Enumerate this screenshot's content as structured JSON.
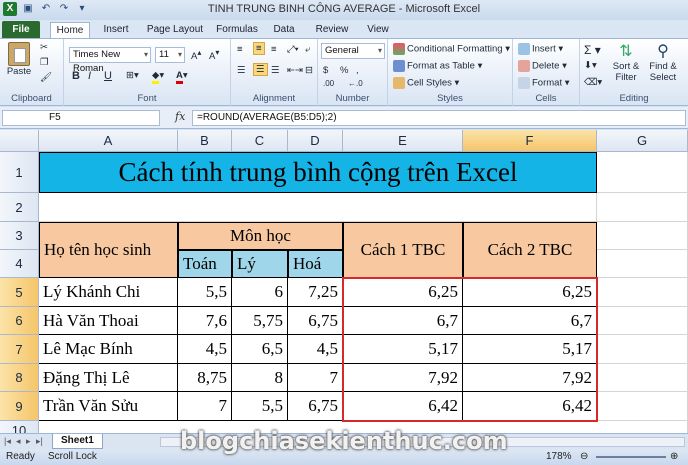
{
  "window": {
    "title": "TINH TRUNG BINH CÔNG AVERAGE - Microsoft Excel"
  },
  "ribbon_tabs": [
    "File",
    "Home",
    "Insert",
    "Page Layout",
    "Formulas",
    "Data",
    "Review",
    "View"
  ],
  "ribbon": {
    "clipboard": {
      "label": "Clipboard",
      "paste": "Paste"
    },
    "font": {
      "label": "Font",
      "font_name": "Times New Roman",
      "font_size": "11",
      "bold": "B",
      "italic": "I",
      "underline": "U"
    },
    "alignment": {
      "label": "Alignment"
    },
    "number": {
      "label": "Number",
      "format": "General",
      "currency": "$",
      "percent": "%",
      "comma": ",",
      "inc_decimal": ".00",
      "dec_decimal": "←.0"
    },
    "styles": {
      "label": "Styles",
      "conditional": "Conditional Formatting",
      "format_table": "Format as Table",
      "cell_styles": "Cell Styles"
    },
    "cells": {
      "label": "Cells",
      "insert": "Insert",
      "delete": "Delete",
      "format": "Format"
    },
    "editing": {
      "label": "Editing",
      "sum": "Σ",
      "sort_filter": "Sort & Filter",
      "find_select": "Find & Select"
    }
  },
  "formula_bar": {
    "name_box": "F5",
    "fx": "fx",
    "formula": "=ROUND(AVERAGE(B5:D5);2)"
  },
  "columns": [
    "A",
    "B",
    "C",
    "D",
    "E",
    "F",
    "G"
  ],
  "rows": [
    "1",
    "2",
    "3",
    "4",
    "5",
    "6",
    "7",
    "8",
    "9",
    "10"
  ],
  "sheet": {
    "title": "Cách tính trung bình cộng trên Excel",
    "header_name": "Họ tên học sinh",
    "header_subjects": "Môn học",
    "header_method1": "Cách 1 TBC",
    "header_method2": "Cách 2 TBC",
    "subjects": [
      "Toán",
      "Lý",
      "Hoá"
    ],
    "students": [
      {
        "name": "Lý Khánh Chi",
        "toan": "5,5",
        "ly": "6",
        "hoa": "7,25",
        "tbc1": "6,25",
        "tbc2": "6,25"
      },
      {
        "name": "Hà Văn Thoai",
        "toan": "7,6",
        "ly": "5,75",
        "hoa": "6,75",
        "tbc1": "6,7",
        "tbc2": "6,7"
      },
      {
        "name": "Lê Mạc Bính",
        "toan": "4,5",
        "ly": "6,5",
        "hoa": "4,5",
        "tbc1": "5,17",
        "tbc2": "5,17"
      },
      {
        "name": "Đặng Thị Lê",
        "toan": "8,75",
        "ly": "8",
        "hoa": "7",
        "tbc1": "7,92",
        "tbc2": "7,92"
      },
      {
        "name": "Trần Văn Sửu",
        "toan": "7",
        "ly": "5,5",
        "hoa": "6,75",
        "tbc1": "6,42",
        "tbc2": "6,42"
      }
    ]
  },
  "sheet_tab": "Sheet1",
  "status": {
    "ready": "Ready",
    "scroll_lock": "Scroll Lock",
    "zoom": "178%"
  },
  "watermark": "blogchiasekienthuc.com"
}
